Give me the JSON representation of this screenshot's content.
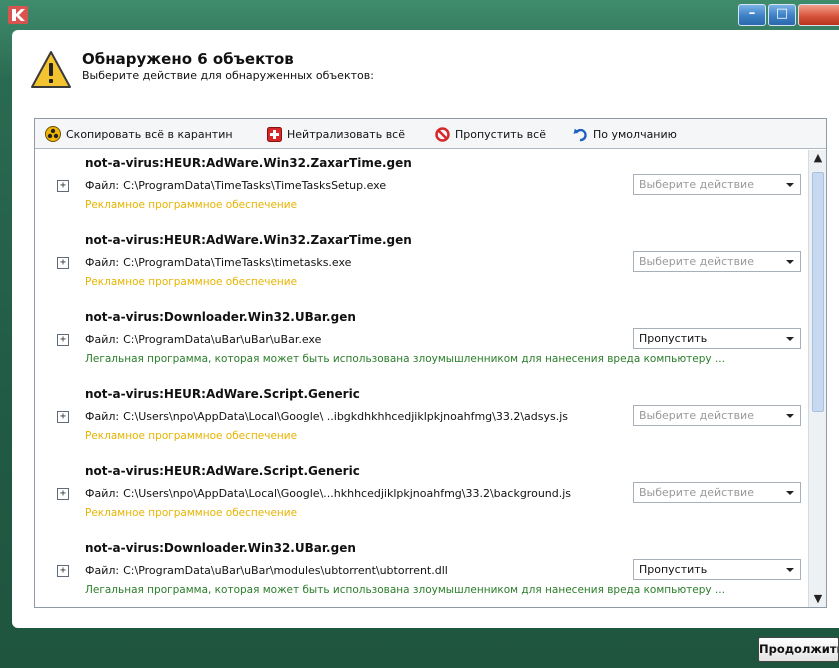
{
  "window": {
    "minimize_glyph": "–",
    "maximize_glyph": "□",
    "close_glyph": ""
  },
  "header": {
    "title": "Обнаружено 6 объектов",
    "subtitle": "Выберите действие для обнаруженных объектов:"
  },
  "toolbar": {
    "quarantine_all": "Скопировать всё в карантин",
    "neutralize_all": "Нейтрализовать всё",
    "skip_all": "Пропустить всё",
    "default": "По умолчанию"
  },
  "file_label": "Файл:",
  "threats": [
    {
      "name": "not-a-virus:HEUR:AdWare.Win32.ZaxarTime.gen",
      "path": "C:\\ProgramData\\TimeTasks\\TimeTasksSetup.exe",
      "description": "Рекламное программное обеспечение",
      "action": "Выберите действие"
    },
    {
      "name": "not-a-virus:HEUR:AdWare.Win32.ZaxarTime.gen",
      "path": "C:\\ProgramData\\TimeTasks\\timetasks.exe",
      "description": "Рекламное программное обеспечение",
      "action": "Выберите действие"
    },
    {
      "name": "not-a-virus:Downloader.Win32.UBar.gen",
      "path": "C:\\ProgramData\\uBar\\uBar\\uBar.exe",
      "description": "Легальная программа, которая может быть использована злоумышленником для нанесения вреда компьютеру ...",
      "action": "Пропустить"
    },
    {
      "name": "not-a-virus:HEUR:AdWare.Script.Generic",
      "path": "C:\\Users\\npo\\AppData\\Local\\Google\\ ..ibgkdhkhhcedjiklpkjnoahfmg\\33.2\\adsys.js",
      "description": "Рекламное программное обеспечение",
      "action": "Выберите действие"
    },
    {
      "name": "not-a-virus:HEUR:AdWare.Script.Generic",
      "path": "C:\\Users\\npo\\AppData\\Local\\Google\\...hkhhcedjiklpkjnoahfmg\\33.2\\background.js",
      "description": "Рекламное программное обеспечение",
      "action": "Выберите действие"
    },
    {
      "name": "not-a-virus:Downloader.Win32.UBar.gen",
      "path": "C:\\ProgramData\\uBar\\uBar\\modules\\ubtorrent\\ubtorrent.dll",
      "description": "Легальная программа, которая может быть использована злоумышленником для нанесения вреда компьютеру ...",
      "action": "Пропустить"
    }
  ],
  "footer": {
    "continue_label": "Продолжить"
  },
  "icons": {
    "app": "kaspersky-logo",
    "header": "warning-icon",
    "quarantine": "biohazard-icon",
    "neutralize": "medical-cross-icon",
    "skip": "no-entry-icon",
    "default": "undo-arrow-icon",
    "expand": "plus-box-icon"
  },
  "colors": {
    "frame": "#2b6a52",
    "adware_text": "#e6b400",
    "legal_text": "#2a7d2a",
    "accent_red": "#cc2222"
  }
}
